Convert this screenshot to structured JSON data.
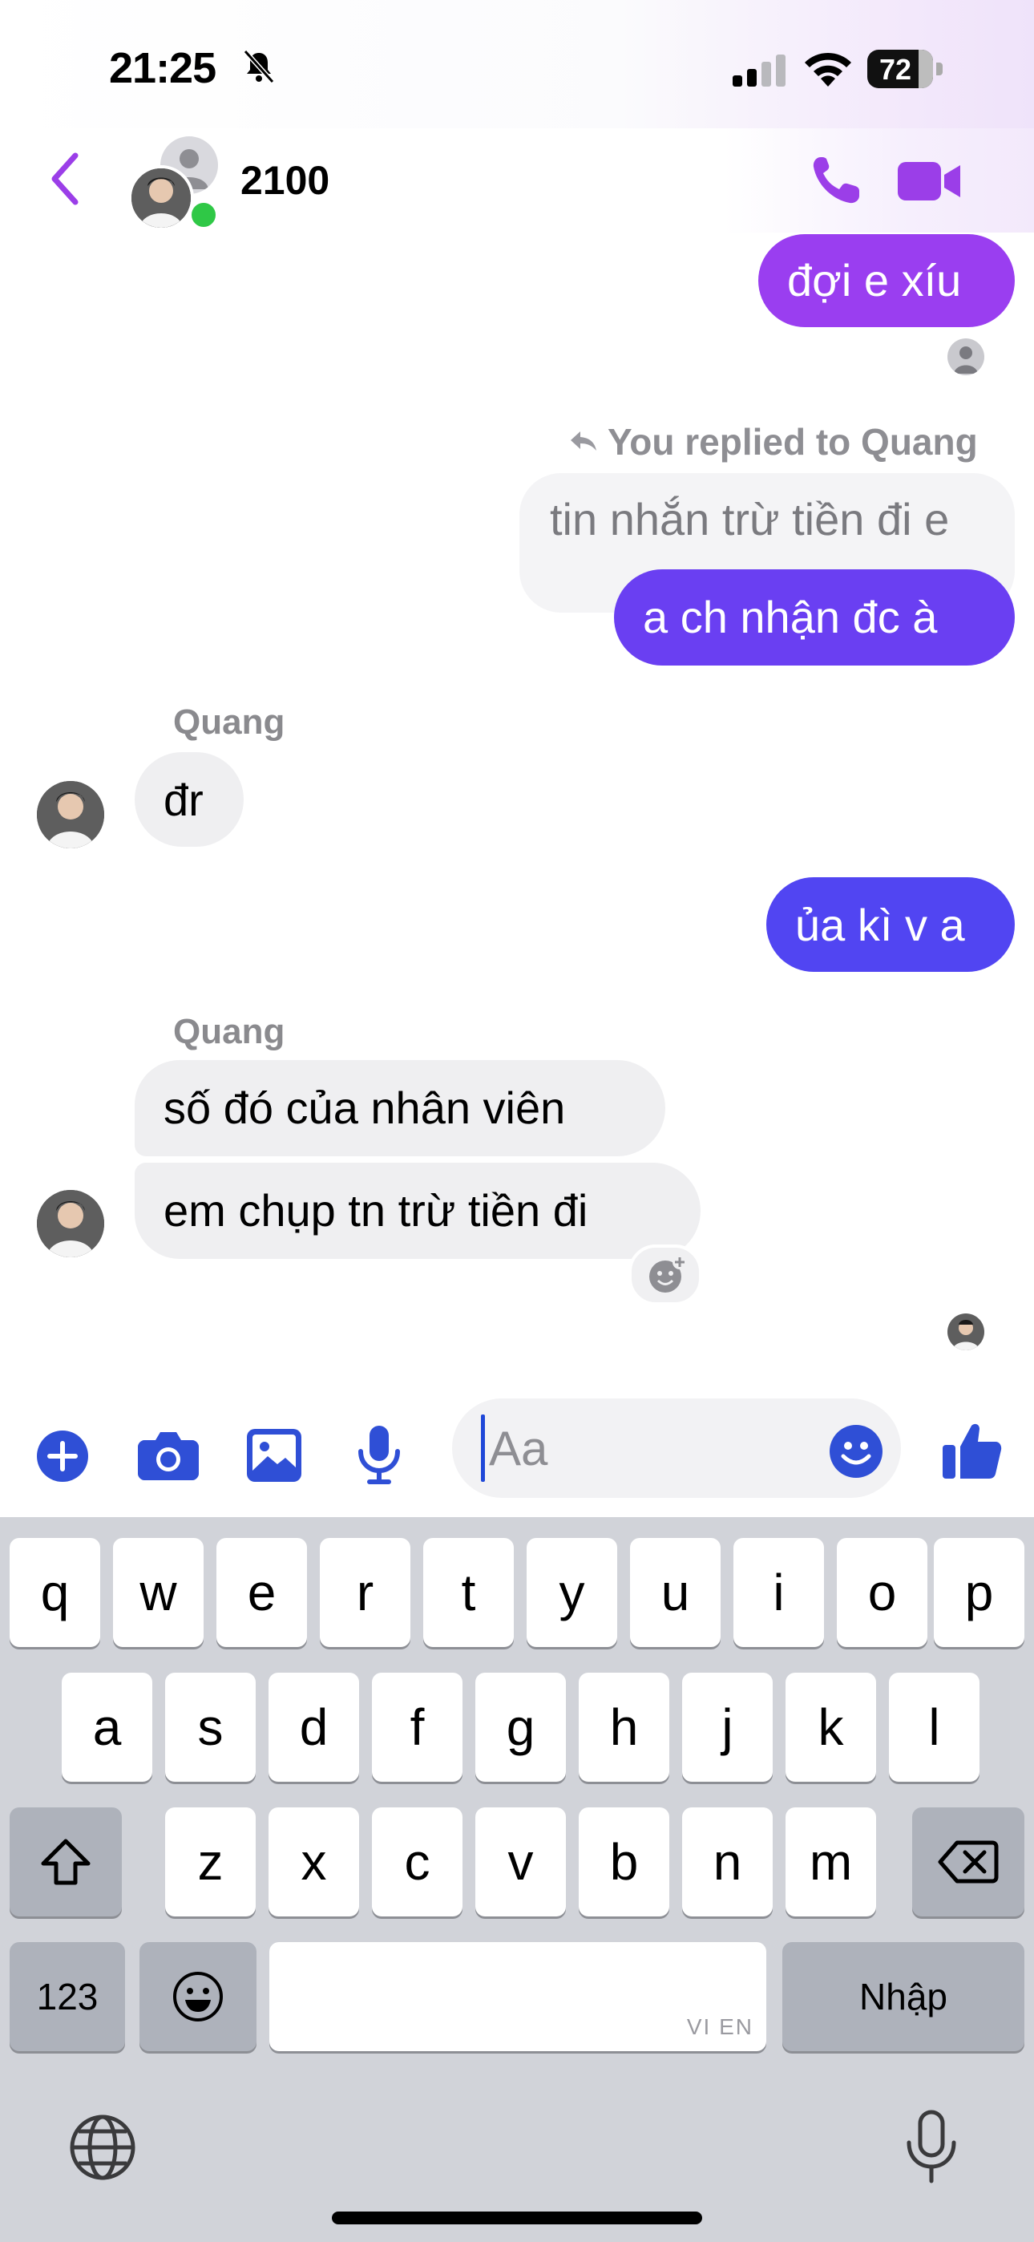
{
  "status_bar": {
    "time": "21:25",
    "battery_percent": "72"
  },
  "header": {
    "title": "2100"
  },
  "messages": {
    "m1": "đợi e xíu",
    "reply_note": "You replied to Quang",
    "quoted": "tin nhắn trừ tiền đi e",
    "m2": "a ch nhận đc à",
    "sender1": "Quang",
    "m3": "đr",
    "m4": "ủa kì v a",
    "sender2": "Quang",
    "m5": "số đó của nhân viên",
    "m6": "em chụp tn trừ tiền đi"
  },
  "composer": {
    "placeholder": "Aa"
  },
  "keyboard": {
    "row1": [
      "q",
      "w",
      "e",
      "r",
      "t",
      "y",
      "u",
      "i",
      "o",
      "p"
    ],
    "row2": [
      "a",
      "s",
      "d",
      "f",
      "g",
      "h",
      "j",
      "k",
      "l"
    ],
    "row3": [
      "z",
      "x",
      "c",
      "v",
      "b",
      "n",
      "m"
    ],
    "numbers_key": "123",
    "return_key": "Nhập",
    "space_hint": "VI EN"
  },
  "colors": {
    "outgoing_top": "#9a3ef0",
    "outgoing_mid": "#6a3ff2",
    "outgoing_bottom": "#5145f2",
    "incoming": "#efeff1",
    "accent_purple": "#9b3ee8",
    "composer_blue": "#2f4fd6"
  }
}
